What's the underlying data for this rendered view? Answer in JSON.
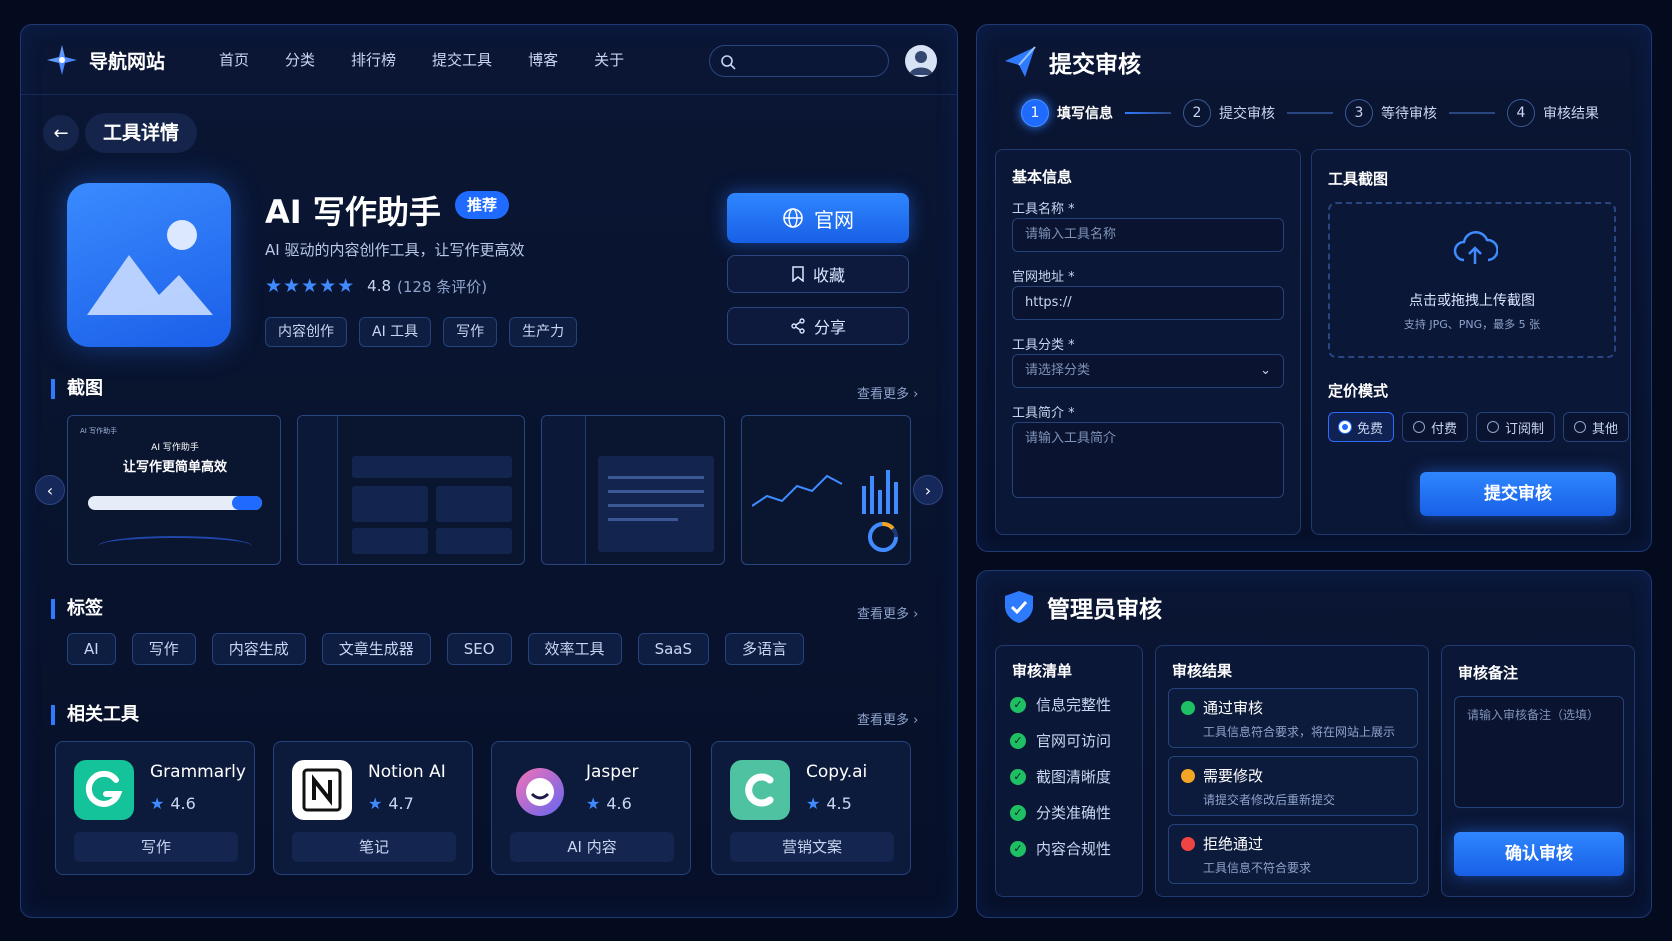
{
  "nav": {
    "brand": "导航网站",
    "links": [
      "首页",
      "分类",
      "排行榜",
      "提交工具",
      "博客",
      "关于"
    ]
  },
  "detail": {
    "page_title": "工具详情",
    "name": "AI 写作助手",
    "badge": "推荐",
    "description": "AI 驱动的内容创作工具，让写作更高效",
    "rating": "4.8",
    "reviews": "(128 条评价)",
    "tags": [
      "内容创作",
      "AI 工具",
      "写作",
      "生产力"
    ],
    "official_btn": "官网",
    "collect_btn": "收藏",
    "share_btn": "分享"
  },
  "screenshots": {
    "title": "截图",
    "more": "查看更多",
    "shot1_small": "AI 写作助手",
    "shot1_title": "AI 写作助手",
    "shot1_sub": "让写作更简单高效"
  },
  "labels": {
    "title": "标签",
    "more": "查看更多",
    "items": [
      "AI",
      "写作",
      "内容生成",
      "文章生成器",
      "SEO",
      "效率工具",
      "SaaS",
      "多语言"
    ]
  },
  "related": {
    "title": "相关工具",
    "more": "查看更多",
    "items": [
      {
        "name": "Grammarly",
        "rating": "4.6",
        "category": "写作",
        "color": "#15c39a"
      },
      {
        "name": "Notion AI",
        "rating": "4.7",
        "category": "笔记",
        "color": "#ffffff"
      },
      {
        "name": "Jasper",
        "rating": "4.6",
        "category": "AI 内容",
        "color": "#8b5cf6"
      },
      {
        "name": "Copy.ai",
        "rating": "4.5",
        "category": "营销文案",
        "color": "#4fc3a1"
      }
    ]
  },
  "submit": {
    "title": "提交审核",
    "steps": [
      {
        "num": "1",
        "label": "填写信息"
      },
      {
        "num": "2",
        "label": "提交审核"
      },
      {
        "num": "3",
        "label": "等待审核"
      },
      {
        "num": "4",
        "label": "审核结果"
      }
    ],
    "basic_title": "基本信息",
    "name_label": "工具名称 *",
    "name_placeholder": "请输入工具名称",
    "url_label": "官网地址 *",
    "url_value": "https://",
    "cat_label": "工具分类 *",
    "cat_placeholder": "请选择分类",
    "intro_label": "工具简介 *",
    "intro_placeholder": "请输入工具简介",
    "shot_title": "工具截图",
    "upload_text": "点击或拖拽上传截图",
    "upload_hint": "支持 JPG、PNG，最多 5 张",
    "pricing_title": "定价模式",
    "pricing": [
      "免费",
      "付费",
      "订阅制",
      "其他"
    ],
    "submit_btn": "提交审核"
  },
  "admin": {
    "title": "管理员审核",
    "checklist_title": "审核清单",
    "checklist": [
      "信息完整性",
      "官网可访问",
      "截图清晰度",
      "分类准确性",
      "内容合规性"
    ],
    "result_title": "审核结果",
    "results": [
      {
        "title": "通过审核",
        "desc": "工具信息符合要求，将在网站上展示",
        "color": "#1fbf63"
      },
      {
        "title": "需要修改",
        "desc": "请提交者修改后重新提交",
        "color": "#f5a524"
      },
      {
        "title": "拒绝通过",
        "desc": "工具信息不符合要求",
        "color": "#ef4444"
      }
    ],
    "note_title": "审核备注",
    "note_placeholder": "请输入审核备注（选填）",
    "confirm_btn": "确认审核"
  }
}
